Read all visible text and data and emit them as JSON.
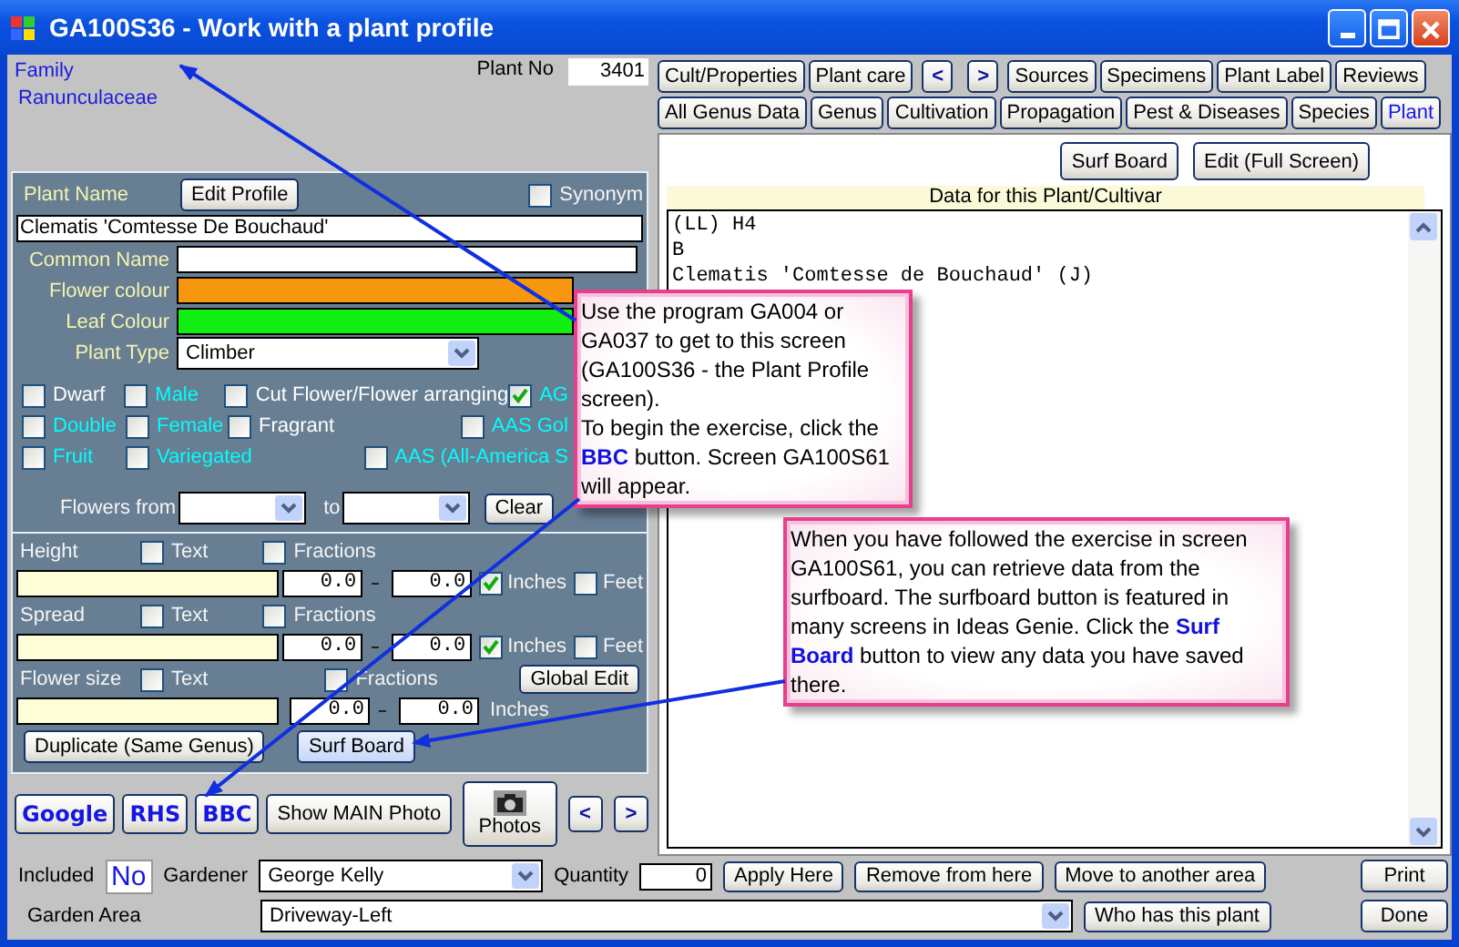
{
  "window": {
    "title": "GA100S36 - Work with a plant profile"
  },
  "family": {
    "label": "Family",
    "value": "Ranunculaceae"
  },
  "plant_no": {
    "label": "Plant No",
    "value": "3401"
  },
  "nav_rows": [
    [
      {
        "label": "Cult/Properties",
        "kind": "text",
        "selected": false
      },
      {
        "label": "Plant care",
        "kind": "text",
        "selected": false
      },
      {
        "label": "<",
        "kind": "arrow",
        "selected": false
      },
      {
        "label": ">",
        "kind": "arrow",
        "selected": false
      },
      {
        "label": "Sources",
        "kind": "text",
        "selected": false
      },
      {
        "label": "Specimens",
        "kind": "text",
        "selected": false
      },
      {
        "label": "Plant Label",
        "kind": "text",
        "selected": false
      },
      {
        "label": "Reviews",
        "kind": "text",
        "selected": false
      }
    ],
    [
      {
        "label": "All Genus Data",
        "kind": "text",
        "selected": false
      },
      {
        "label": "Genus",
        "kind": "text",
        "selected": false
      },
      {
        "label": "Cultivation",
        "kind": "text",
        "selected": false
      },
      {
        "label": "Propagation",
        "kind": "text",
        "selected": false
      },
      {
        "label": "Pest & Diseases",
        "kind": "text",
        "selected": false
      },
      {
        "label": "Species",
        "kind": "text",
        "selected": false
      },
      {
        "label": "Plant",
        "kind": "text",
        "selected": true
      }
    ]
  ],
  "plant_name": {
    "label": "Plant Name",
    "edit_button": "Edit Profile",
    "synonym": {
      "label": "Synonym",
      "checked": false
    },
    "value": "Clematis 'Comtesse De Bouchaud'"
  },
  "common_name": {
    "label": "Common Name"
  },
  "colours": [
    {
      "label": "Flower colour",
      "color": "#f7960f"
    },
    {
      "label": "Leaf Colour",
      "color": "#11ee11"
    }
  ],
  "plant_type": {
    "label": "Plant Type",
    "value": "Climber"
  },
  "flag_rows": [
    [
      {
        "label": "Dwarf",
        "checked": false,
        "color": "#ffffff"
      },
      {
        "label": "Male",
        "checked": false,
        "color": "#00ffff"
      },
      {
        "label": "Cut Flower/Flower arranging",
        "checked": false,
        "color": "#ffffff"
      },
      {
        "label": "AG",
        "checked": true,
        "color": "#00ffff"
      }
    ],
    [
      {
        "label": "Double",
        "checked": false,
        "color": "#00ffff"
      },
      {
        "label": "Female",
        "checked": false,
        "color": "#00ffff"
      },
      {
        "label": "Fragrant",
        "checked": false,
        "color": "#ffffff"
      },
      {
        "label": "AAS Gol",
        "checked": false,
        "color": "#00ffff"
      }
    ],
    [
      {
        "label": "Fruit",
        "checked": false,
        "color": "#00ffff"
      },
      {
        "label": "Variegated",
        "checked": false,
        "color": "#00ffff"
      },
      {
        "label": "AAS (All-America S",
        "checked": false,
        "color": "#00ffff"
      }
    ]
  ],
  "flowers": {
    "from_label": "Flowers from",
    "to_label": "to",
    "clear_button": "Clear"
  },
  "measures": [
    {
      "label": "Height",
      "text": {
        "label": "Text",
        "checked": false
      },
      "fractions": {
        "label": "Fractions",
        "checked": false
      },
      "min": "0.0",
      "max": "0.0",
      "units": [
        {
          "label": "Inches",
          "checked": true
        },
        {
          "label": "Feet",
          "checked": false
        }
      ]
    },
    {
      "label": "Spread",
      "text": {
        "label": "Text",
        "checked": false
      },
      "fractions": {
        "label": "Fractions",
        "checked": false
      },
      "min": "0.0",
      "max": "0.0",
      "units": [
        {
          "label": "Inches",
          "checked": true
        },
        {
          "label": "Feet",
          "checked": false
        }
      ]
    },
    {
      "label": "Flower size",
      "text": {
        "label": "Text",
        "checked": false
      },
      "fractions": {
        "label": "Fractions",
        "checked": false
      },
      "min": "0.0",
      "max": "0.0",
      "unit": "Inches",
      "button": "Global Edit"
    }
  ],
  "panel_buttons": [
    "Duplicate (Same Genus)",
    "Surf Board"
  ],
  "link_buttons": [
    "Google",
    "RHS",
    "BBC"
  ],
  "photo_buttons": {
    "show_main": "Show MAIN Photo",
    "photos": "Photos",
    "prev": "<",
    "next": ">"
  },
  "data_pane": {
    "buttons": [
      "Surf Board",
      "Edit (Full Screen)"
    ],
    "header": "Data for this Plant/Cultivar",
    "lines": [
      "(LL) H4",
      "B",
      "Clematis 'Comtesse de Bouchaud' (J)"
    ]
  },
  "bottom": {
    "included": {
      "label": "Included",
      "value": "No"
    },
    "gardener": {
      "label": "Gardener",
      "value": "George Kelly"
    },
    "quantity": {
      "label": "Quantity",
      "value": "0"
    },
    "actions": [
      "Apply Here",
      "Remove from here",
      "Move to another area"
    ],
    "print": "Print",
    "garden_area": {
      "label": "Garden Area",
      "value": "Driveway-Left"
    },
    "who": "Who has this plant",
    "done": "Done"
  },
  "callouts": [
    {
      "text": "Use the program GA004 or GA037 to get to this screen (GA100S36 - the Plant Profile screen).\nTo begin the exercise, click the **BBC** button. Screen GA100S61 will appear."
    },
    {
      "text": "When you have followed the exercise in screen GA100S61, you can retrieve data from the surfboard. The surfboard button is featured in many screens in Ideas Genie. Click the **Surf Board** button to view any data you have saved there."
    }
  ]
}
